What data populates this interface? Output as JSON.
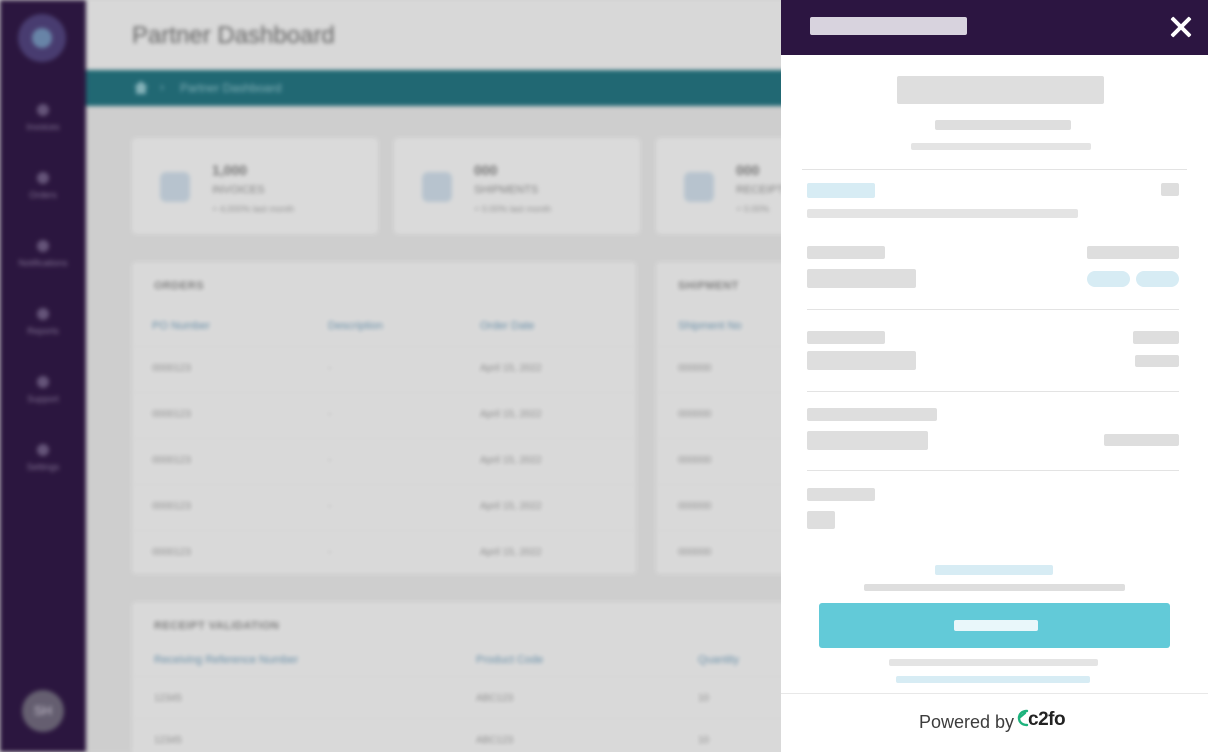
{
  "background": {
    "app_title": "Partner Dashboard",
    "breadcrumb": {
      "home_icon": "home-icon",
      "current": "Partner Dashboard"
    },
    "nav": [
      {
        "label": "Invoices",
        "icon": "invoice-icon"
      },
      {
        "label": "Orders",
        "icon": "orders-icon"
      },
      {
        "label": "Notifications",
        "icon": "bell-icon"
      },
      {
        "label": "Reports",
        "icon": "chart-icon"
      },
      {
        "label": "Support",
        "icon": "help-icon"
      },
      {
        "label": "Settings",
        "icon": "gear-icon"
      }
    ],
    "avatar_initials": "SH",
    "stats": [
      {
        "number": "1,000",
        "label": "INVOICES",
        "sub": "+ 4,000% last month"
      },
      {
        "number": "000",
        "label": "SHIPMENTS",
        "sub": "+ 0.00% last month"
      },
      {
        "number": "000",
        "label": "RECEIPTS",
        "sub": "+ 0.00%"
      }
    ],
    "orders_panel": {
      "title": "ORDERS",
      "columns": [
        "PO Number",
        "Description",
        "Order Date"
      ],
      "rows": [
        [
          "0000123",
          "-",
          "April 15, 2022"
        ],
        [
          "0000123",
          "-",
          "April 15, 2022"
        ],
        [
          "0000123",
          "-",
          "April 15, 2022"
        ],
        [
          "0000123",
          "-",
          "April 15, 2022"
        ],
        [
          "0000123",
          "-",
          "April 15, 2022"
        ]
      ]
    },
    "shipment_panel": {
      "title": "SHIPMENT",
      "columns": [
        "Shipment No"
      ],
      "rows": [
        [
          "000000"
        ],
        [
          "000000"
        ],
        [
          "000000"
        ],
        [
          "000000"
        ],
        [
          "000000"
        ]
      ]
    },
    "receipt_panel": {
      "title": "RECEIPT VALIDATION",
      "columns": [
        "Receiving Reference Number",
        "Product Code",
        "Quantity"
      ],
      "rows": [
        [
          "12345",
          "ABC123",
          "10"
        ],
        [
          "12345",
          "ABC123",
          "10"
        ]
      ]
    }
  },
  "drawer": {
    "footer": {
      "powered_by": "Powered by",
      "brand": "c2fo"
    },
    "colors": {
      "header": "#2c1541",
      "cta": "#62cad8",
      "skeleton": "#dedede"
    }
  }
}
